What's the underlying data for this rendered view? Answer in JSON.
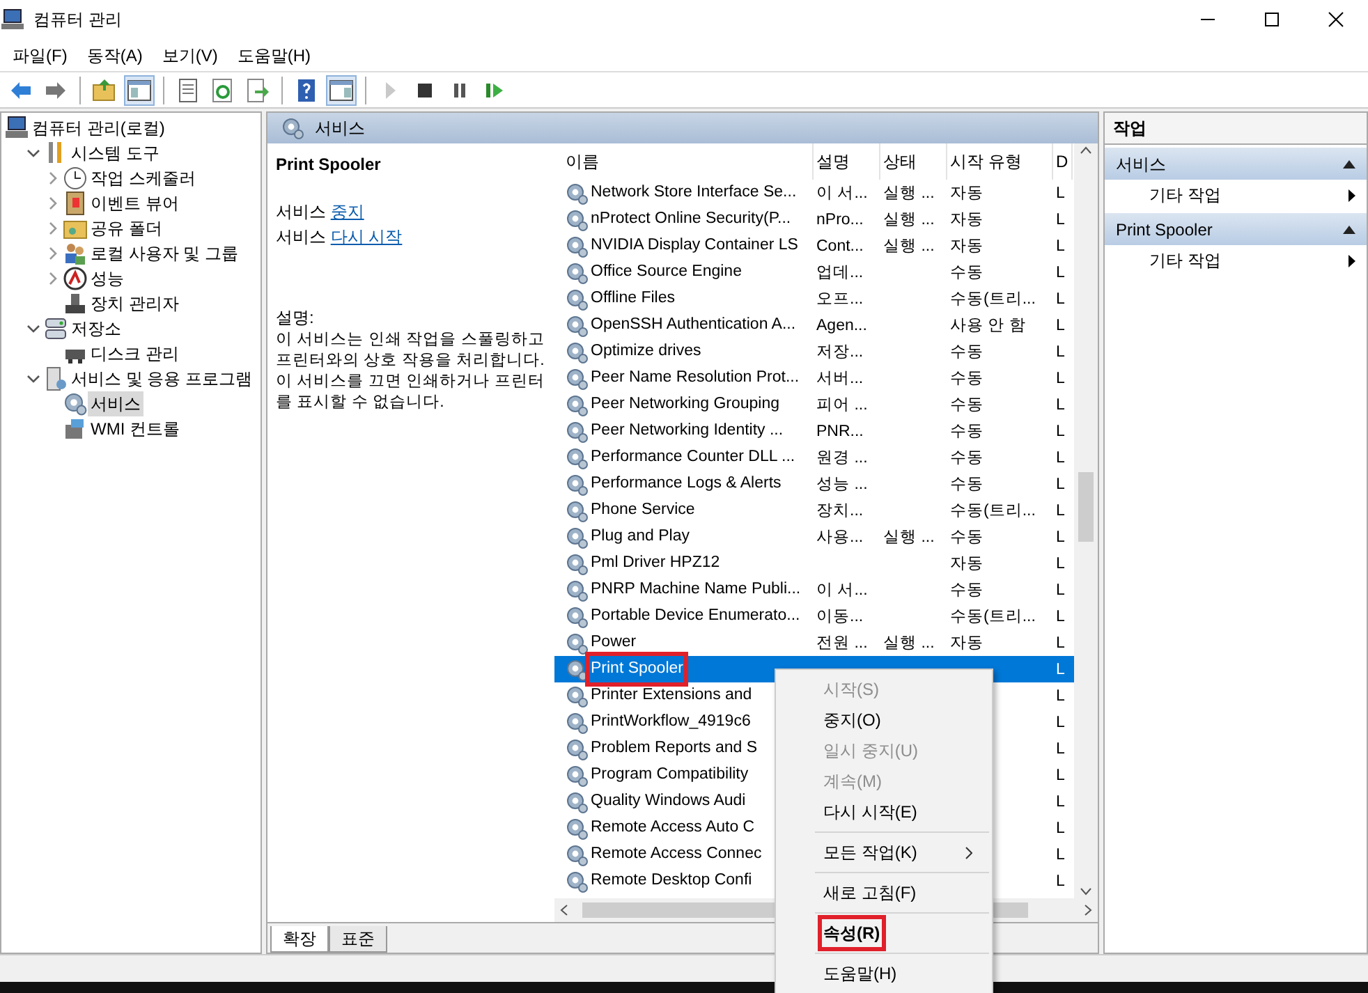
{
  "window": {
    "title": "컴퓨터 관리"
  },
  "menu": [
    "파일(F)",
    "동작(A)",
    "보기(V)",
    "도움말(H)"
  ],
  "toolbar": [
    {
      "kind": "back"
    },
    {
      "kind": "forward"
    },
    {
      "kind": "sep"
    },
    {
      "kind": "up"
    },
    {
      "kind": "tree",
      "pressed": true
    },
    {
      "kind": "sep"
    },
    {
      "kind": "list"
    },
    {
      "kind": "refresh"
    },
    {
      "kind": "export"
    },
    {
      "kind": "sep"
    },
    {
      "kind": "help"
    },
    {
      "kind": "pane",
      "pressed": true
    },
    {
      "kind": "sep"
    },
    {
      "kind": "play",
      "disabled": true
    },
    {
      "kind": "stop"
    },
    {
      "kind": "pause"
    },
    {
      "kind": "resume"
    }
  ],
  "tree": [
    {
      "label": "컴퓨터 관리(로컬)",
      "kind": "computer",
      "selected": false,
      "children": [
        {
          "label": "시스템 도구",
          "kind": "tools",
          "expanded": true,
          "selected": false,
          "children": [
            {
              "label": "작업 스케줄러",
              "kind": "clock",
              "expanded": false,
              "selected": false
            },
            {
              "label": "이벤트 뷰어",
              "kind": "log",
              "expanded": false,
              "selected": false
            },
            {
              "label": "공유 폴더",
              "kind": "folder",
              "expanded": false,
              "selected": false
            },
            {
              "label": "로컬 사용자 및 그룹",
              "kind": "users",
              "expanded": false,
              "selected": false
            },
            {
              "label": "성능",
              "kind": "perf",
              "expanded": false,
              "selected": false
            },
            {
              "label": "장치 관리자",
              "kind": "device",
              "selected": false
            }
          ]
        },
        {
          "label": "저장소",
          "kind": "storage",
          "expanded": true,
          "selected": false,
          "children": [
            {
              "label": "디스크 관리",
              "kind": "disk",
              "selected": false
            }
          ]
        },
        {
          "label": "서비스 및 응용 프로그램",
          "kind": "apps",
          "expanded": true,
          "selected": false,
          "children": [
            {
              "label": "서비스",
              "kind": "services",
              "selected": true
            },
            {
              "label": "WMI 컨트롤",
              "kind": "wmi",
              "selected": false
            }
          ]
        }
      ]
    }
  ],
  "center": {
    "header": "서비스",
    "detail": {
      "title": "Print Spooler",
      "links": [
        {
          "prefix": "서비스",
          "link": "중지"
        },
        {
          "prefix": "서비스",
          "link": "다시 시작"
        }
      ],
      "description_label": "설명:",
      "description": "이 서비스는 인쇄 작업을 스풀링하고 프린터와의 상호 작용을 처리합니다. 이 서비스를 끄면 인쇄하거나 프린터를 표시할 수 없습니다."
    },
    "table": {
      "columns": [
        "이름",
        "설명",
        "상태",
        "시작 유형",
        "D"
      ],
      "rows": [
        {
          "name": "Network Store Interface Se...",
          "desc": "이 서...",
          "status": "실행 ...",
          "start": "자동",
          "column_5": "L",
          "selected": false
        },
        {
          "name": "nProtect Online Security(P...",
          "desc": "nPro...",
          "status": "실행 ...",
          "start": "자동",
          "column_5": "L",
          "selected": false
        },
        {
          "name": "NVIDIA Display Container LS",
          "desc": "Cont...",
          "status": "실행 ...",
          "start": "자동",
          "column_5": "L",
          "selected": false
        },
        {
          "name": "Office  Source Engine",
          "desc": "업데...",
          "start": "수동",
          "column_5": "L",
          "selected": false
        },
        {
          "name": "Offline Files",
          "desc": "오프...",
          "start": "수동(트리...",
          "column_5": "L",
          "selected": false
        },
        {
          "name": "OpenSSH Authentication A...",
          "desc": "Agen...",
          "start": "사용 안 함",
          "column_5": "L",
          "selected": false
        },
        {
          "name": "Optimize drives",
          "desc": "저장...",
          "start": "수동",
          "column_5": "L",
          "selected": false
        },
        {
          "name": "Peer Name Resolution Prot...",
          "desc": "서버...",
          "start": "수동",
          "column_5": "L",
          "selected": false
        },
        {
          "name": "Peer Networking Grouping",
          "desc": "피어 ...",
          "start": "수동",
          "column_5": "L",
          "selected": false
        },
        {
          "name": "Peer Networking Identity ...",
          "desc": "PNR...",
          "start": "수동",
          "column_5": "L",
          "selected": false
        },
        {
          "name": "Performance Counter DLL ...",
          "desc": "원경 ...",
          "start": "수동",
          "column_5": "L",
          "selected": false
        },
        {
          "name": "Performance Logs & Alerts",
          "desc": "성능 ...",
          "start": "수동",
          "column_5": "L",
          "selected": false
        },
        {
          "name": "Phone Service",
          "desc": "장치...",
          "start": "수동(트리...",
          "column_5": "L",
          "selected": false
        },
        {
          "name": "Plug and Play",
          "desc": "사용...",
          "status": "실행 ...",
          "start": "수동",
          "column_5": "L",
          "selected": false
        },
        {
          "name": "Pml Driver HPZ12",
          "start": "자동",
          "column_5": "L",
          "selected": false
        },
        {
          "name": "PNRP Machine Name Publi...",
          "desc": "이 서...",
          "start": "수동",
          "column_5": "L",
          "selected": false
        },
        {
          "name": "Portable Device Enumerato...",
          "desc": "이동...",
          "start": "수동(트리...",
          "column_5": "L",
          "selected": false
        },
        {
          "name": "Power",
          "desc": "전원 ...",
          "status": "실행 ...",
          "start": "자동",
          "column_5": "L",
          "selected": false
        },
        {
          "name": "Print Spooler",
          "column_5": "L",
          "selected": true,
          "highlighted": true
        },
        {
          "name": "Printer Extensions and",
          "column_5": "L",
          "selected": false
        },
        {
          "name": "PrintWorkflow_4919c6",
          "column_5": "L",
          "selected": false
        },
        {
          "name": "Problem Reports and S",
          "column_5": "L",
          "selected": false
        },
        {
          "name": "Program Compatibility",
          "column_5": "L",
          "selected": false
        },
        {
          "name": "Quality Windows Audi",
          "column_5": "L",
          "selected": false
        },
        {
          "name": "Remote Access Auto C",
          "column_5": "L",
          "selected": false
        },
        {
          "name": "Remote Access Connec",
          "column_5": "L",
          "selected": false
        },
        {
          "name": "Remote Desktop Confi",
          "column_5": "L",
          "selected": false
        }
      ]
    },
    "tabs": [
      {
        "label": "확장",
        "selected": true
      },
      {
        "label": "표준",
        "selected": false
      }
    ]
  },
  "actions": {
    "title": "작업",
    "sections": [
      {
        "title": "서비스",
        "items": [
          "기타 작업"
        ]
      },
      {
        "title": "Print Spooler",
        "items": [
          "기타 작업"
        ]
      }
    ]
  },
  "context_menu": [
    {
      "kind": "item",
      "label": "시작(S)",
      "disabled": true
    },
    {
      "kind": "item",
      "label": "중지(O)",
      "disabled": false
    },
    {
      "kind": "item",
      "label": "일시 중지(U)",
      "disabled": true
    },
    {
      "kind": "item",
      "label": "계속(M)",
      "disabled": true
    },
    {
      "kind": "item",
      "label": "다시 시작(E)",
      "disabled": false
    },
    {
      "kind": "separator"
    },
    {
      "kind": "submenu",
      "label": "모든 작업(K)",
      "disabled": false
    },
    {
      "kind": "separator"
    },
    {
      "kind": "item",
      "label": "새로 고침(F)",
      "disabled": false
    },
    {
      "kind": "separator"
    },
    {
      "kind": "item",
      "label": "속성(R)",
      "disabled": false,
      "default": true,
      "highlighted": true
    },
    {
      "kind": "separator"
    },
    {
      "kind": "item",
      "label": "도움말(H)",
      "disabled": false
    }
  ]
}
